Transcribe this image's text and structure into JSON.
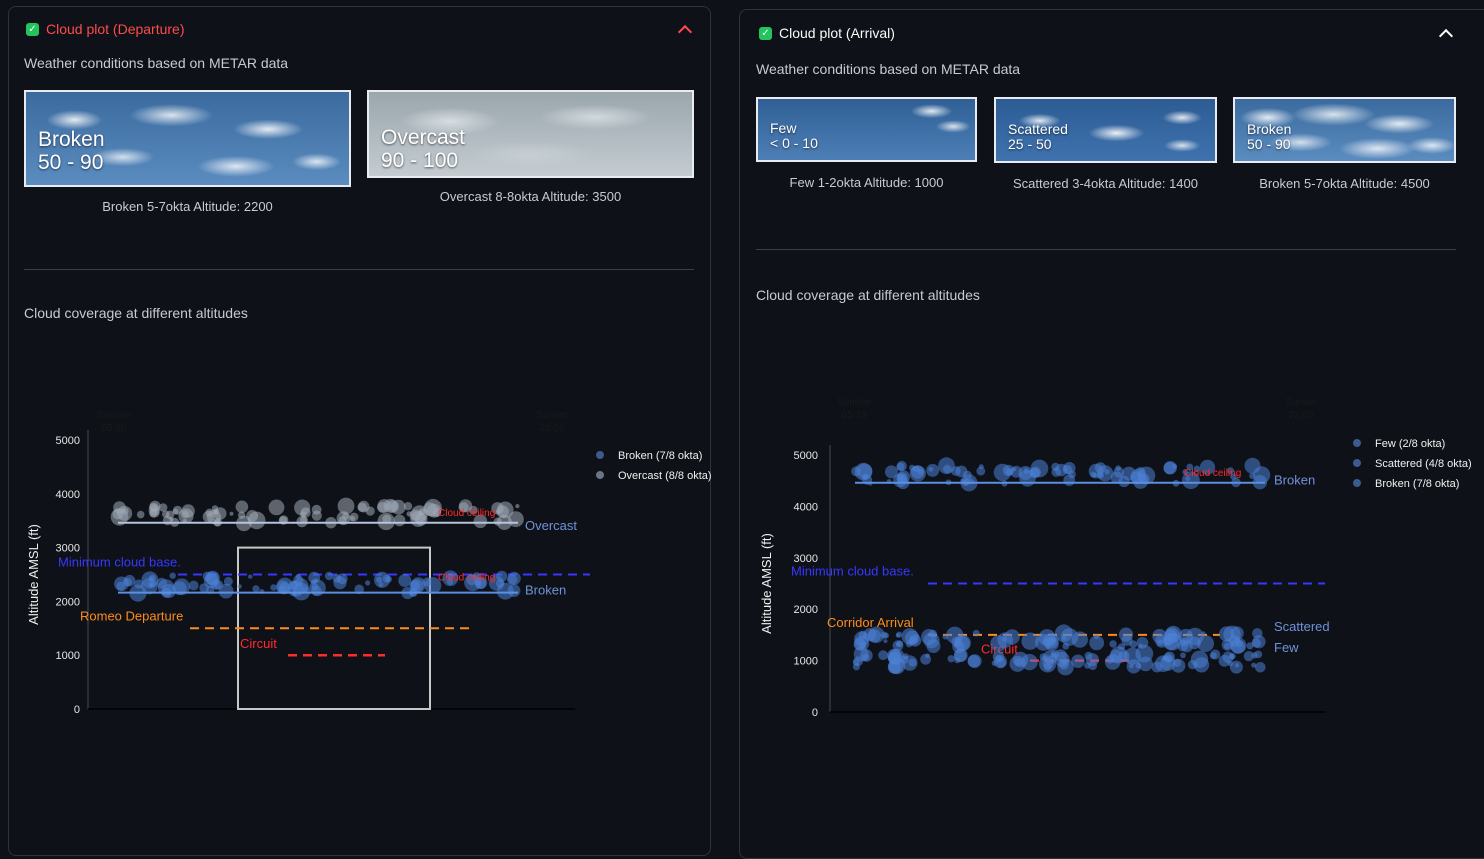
{
  "colors": {
    "background": "#0e1117",
    "red": "#ff4b4b",
    "green": "#23c45e",
    "blue_line": "#4a7fd4",
    "purple": "#3838ff",
    "orange": "#ff8c1a"
  },
  "left": {
    "header": {
      "label": "Cloud plot (Departure)",
      "icon": "check-icon",
      "chevron": "chevron-up-icon"
    },
    "subtitle": "Weather conditions based on METAR data",
    "images": [
      {
        "line1": "Broken",
        "line2": "50 - 90",
        "caption": "Broken 5-7okta Altitude: 2200"
      },
      {
        "line1": "Overcast",
        "line2": "90 - 100",
        "caption": "Overcast 8-8okta Altitude: 3500"
      }
    ],
    "section_title": "Cloud coverage at different altitudes"
  },
  "right": {
    "header": {
      "label": "Cloud plot (Arrival)",
      "icon": "check-icon",
      "chevron": "chevron-up-icon"
    },
    "subtitle": "Weather conditions based on METAR data",
    "images": [
      {
        "line1": "Few",
        "line2": "< 0 - 10",
        "caption": "Few 1-2okta Altitude: 1000"
      },
      {
        "line1": "Scattered",
        "line2": "25 - 50",
        "caption": "Scattered 3-4okta Altitude: 1400"
      },
      {
        "line1": "Broken",
        "line2": "50 - 90",
        "caption": "Broken 5-7okta Altitude: 4500"
      }
    ],
    "section_title": "Cloud coverage at different altitudes"
  },
  "chart_data": [
    {
      "type": "scatter",
      "ylabel": "Altitude AMSL (ft)",
      "ylim": [
        0,
        5000
      ],
      "yticks": [
        0,
        1000,
        2000,
        3000,
        4000,
        5000
      ],
      "top_labels": [
        {
          "label": "Sunrise",
          "time": "05:20"
        },
        {
          "label": "Sunset",
          "time": "22:00"
        }
      ],
      "series": [
        {
          "name": "Broken (7/8 okta)",
          "altitude": 2200,
          "color": "#4a7fd4"
        },
        {
          "name": "Overcast (8/8 okta)",
          "altitude": 3500,
          "color": "#9fa9b6"
        }
      ],
      "cloud_labels": [
        {
          "text": "Overcast",
          "altitude": 3400
        },
        {
          "text": "Broken",
          "altitude": 2200
        }
      ],
      "ceiling_labels": [
        {
          "text": "Cloud ceiling",
          "altitude": 3400
        },
        {
          "text": "Cloud ceiling",
          "altitude": 2200
        }
      ],
      "ref_lines": [
        {
          "label": "Minimum cloud base.",
          "altitude": 2500,
          "color": "#3838ff"
        },
        {
          "label": "Romeo Departure",
          "altitude": 1500,
          "color": "#ff8c1a"
        },
        {
          "label": "Circuit",
          "altitude": 1000,
          "color": "#ff2b2b"
        }
      ],
      "box": {
        "altitude": 3000
      },
      "legend": "right"
    },
    {
      "type": "scatter",
      "ylabel": "Altitude AMSL (ft)",
      "ylim": [
        0,
        5000
      ],
      "yticks": [
        0,
        1000,
        2000,
        3000,
        4000,
        5000
      ],
      "top_labels": [
        {
          "label": "Sunrise",
          "time": "05:23"
        },
        {
          "label": "Sunset",
          "time": "22:03"
        }
      ],
      "series": [
        {
          "name": "Few (2/8 okta)",
          "altitude": 1000,
          "color": "#4a7fd4"
        },
        {
          "name": "Scattered (4/8 okta)",
          "altitude": 1400,
          "color": "#4a7fd4"
        },
        {
          "name": "Broken (7/8 okta)",
          "altitude": 4500,
          "color": "#4a7fd4"
        }
      ],
      "cloud_labels": [
        {
          "text": "Broken",
          "altitude": 4500
        },
        {
          "text": "Scattered",
          "altitude": 1650
        },
        {
          "text": "Few",
          "altitude": 1250
        }
      ],
      "ceiling_labels": [
        {
          "text": "Cloud ceiling",
          "altitude": 4400
        }
      ],
      "ref_lines": [
        {
          "label": "Minimum cloud base.",
          "altitude": 2500,
          "color": "#3838ff"
        },
        {
          "label": "Corridor Arrival",
          "altitude": 1500,
          "color": "#ff8c1a"
        },
        {
          "label": "Circuit",
          "altitude": 1000,
          "color": "#ff2b2b"
        }
      ],
      "legend": "right"
    }
  ]
}
